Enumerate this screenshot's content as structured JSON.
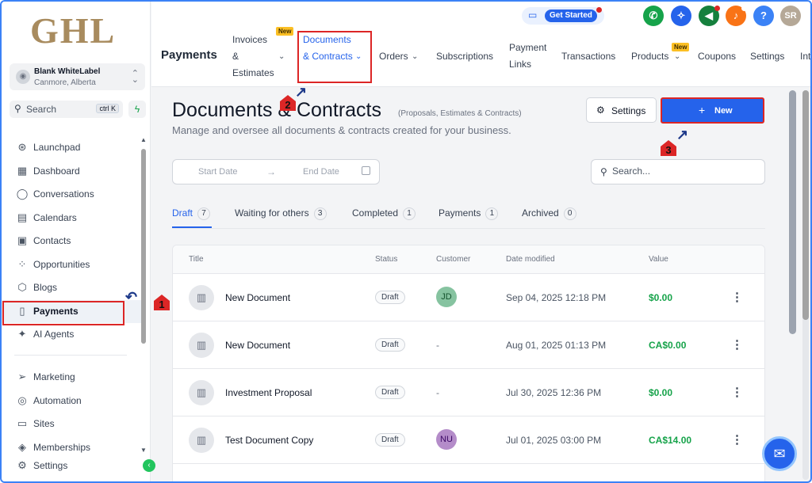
{
  "brand": {
    "logo": "GHL"
  },
  "account": {
    "name": "Blank WhiteLabel",
    "location": "Canmore, Alberta"
  },
  "sidebar_search": {
    "label": "Search",
    "shortcut": "ctrl K"
  },
  "sidebar": {
    "items": [
      {
        "label": "Launchpad",
        "icon": "rocket-icon"
      },
      {
        "label": "Dashboard",
        "icon": "grid-icon"
      },
      {
        "label": "Conversations",
        "icon": "chat-icon"
      },
      {
        "label": "Calendars",
        "icon": "calendar-icon"
      },
      {
        "label": "Contacts",
        "icon": "contacts-icon"
      },
      {
        "label": "Opportunities",
        "icon": "pipeline-icon"
      },
      {
        "label": "Blogs",
        "icon": "cube-icon"
      },
      {
        "label": "Payments",
        "icon": "payments-icon"
      },
      {
        "label": "AI Agents",
        "icon": "sparkle-icon"
      }
    ],
    "items2": [
      {
        "label": "Marketing",
        "icon": "send-icon"
      },
      {
        "label": "Automation",
        "icon": "automation-icon"
      },
      {
        "label": "Sites",
        "icon": "sites-icon"
      },
      {
        "label": "Memberships",
        "icon": "membership-icon"
      },
      {
        "label": "Settings",
        "icon": "gear-icon"
      }
    ]
  },
  "topbar": {
    "get_started": "Get Started",
    "profile_initials": "SR",
    "section_title": "Payments",
    "new_badge": "New",
    "tabs": [
      {
        "label": "Invoices & Estimates"
      },
      {
        "label": "Documents & Contracts"
      },
      {
        "label": "Orders"
      },
      {
        "label": "Subscriptions"
      },
      {
        "label": "Payment Links"
      },
      {
        "label": "Transactions"
      },
      {
        "label": "Products"
      },
      {
        "label": "Coupons"
      },
      {
        "label": "Settings"
      },
      {
        "label": "Int"
      }
    ]
  },
  "page": {
    "title": "Documents & Contracts",
    "subtitle": "(Proposals, Estimates & Contracts)",
    "description": "Manage and oversee all documents & contracts created for your business.",
    "settings_label": "Settings",
    "new_label": "New",
    "start_date": "Start Date",
    "end_date": "End Date",
    "search_placeholder": "Search..."
  },
  "filters": [
    {
      "label": "Draft",
      "count": "7"
    },
    {
      "label": "Waiting for others",
      "count": "3"
    },
    {
      "label": "Completed",
      "count": "1"
    },
    {
      "label": "Payments",
      "count": "1"
    },
    {
      "label": "Archived",
      "count": "0"
    }
  ],
  "table": {
    "columns": [
      "Title",
      "Status",
      "Customer",
      "Date modified",
      "Value"
    ],
    "rows": [
      {
        "title": "New Document",
        "status": "Draft",
        "customer": "JD",
        "date": "Sep 04, 2025 12:18 PM",
        "value": "$0.00"
      },
      {
        "title": "New Document",
        "status": "Draft",
        "customer": "-",
        "date": "Aug 01, 2025 01:13 PM",
        "value": "CA$0.00"
      },
      {
        "title": "Investment Proposal",
        "status": "Draft",
        "customer": "-",
        "date": "Jul 30, 2025 12:36 PM",
        "value": "$0.00"
      },
      {
        "title": "Test Document Copy",
        "status": "Draft",
        "customer": "NU",
        "date": "Jul 01, 2025 03:00 PM",
        "value": "CA$14.00"
      }
    ]
  },
  "annotations": [
    "1",
    "2",
    "3"
  ],
  "colors": {
    "accent": "#2563eb",
    "highlight": "#dc2626",
    "value_green": "#16a34a"
  }
}
